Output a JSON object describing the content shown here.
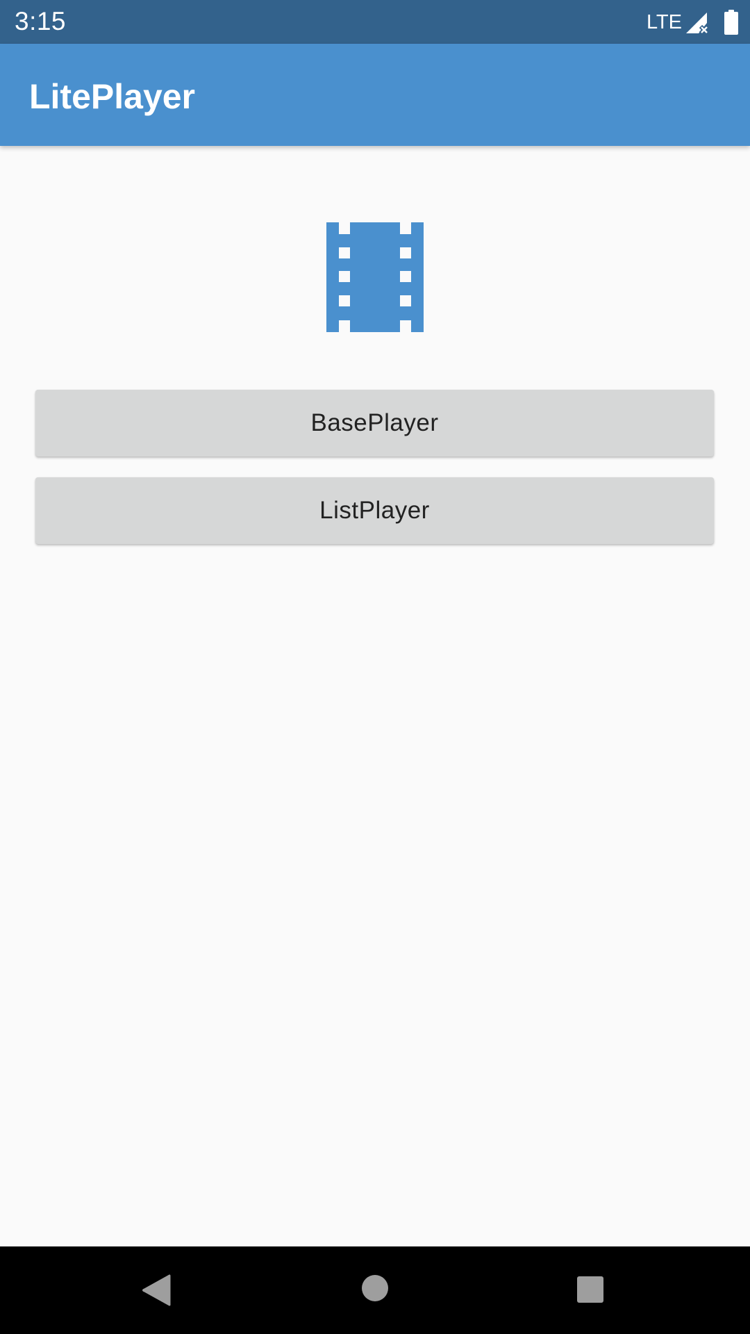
{
  "status_bar": {
    "time": "3:15",
    "network": "LTE",
    "icons": [
      "signal-no-data-icon",
      "battery-icon"
    ]
  },
  "app_bar": {
    "title": "LitePlayer"
  },
  "logo": {
    "icon": "film-strip-icon",
    "color": "#4a90ce"
  },
  "buttons": {
    "base_player": "BasePlayer",
    "list_player": "ListPlayer"
  },
  "nav_bar": {
    "icons": [
      "back-icon",
      "home-icon",
      "recents-icon"
    ]
  },
  "colors": {
    "status_bar": "#33628c",
    "app_bar": "#4a90ce",
    "background": "#fafafa",
    "button": "#d6d7d7"
  }
}
